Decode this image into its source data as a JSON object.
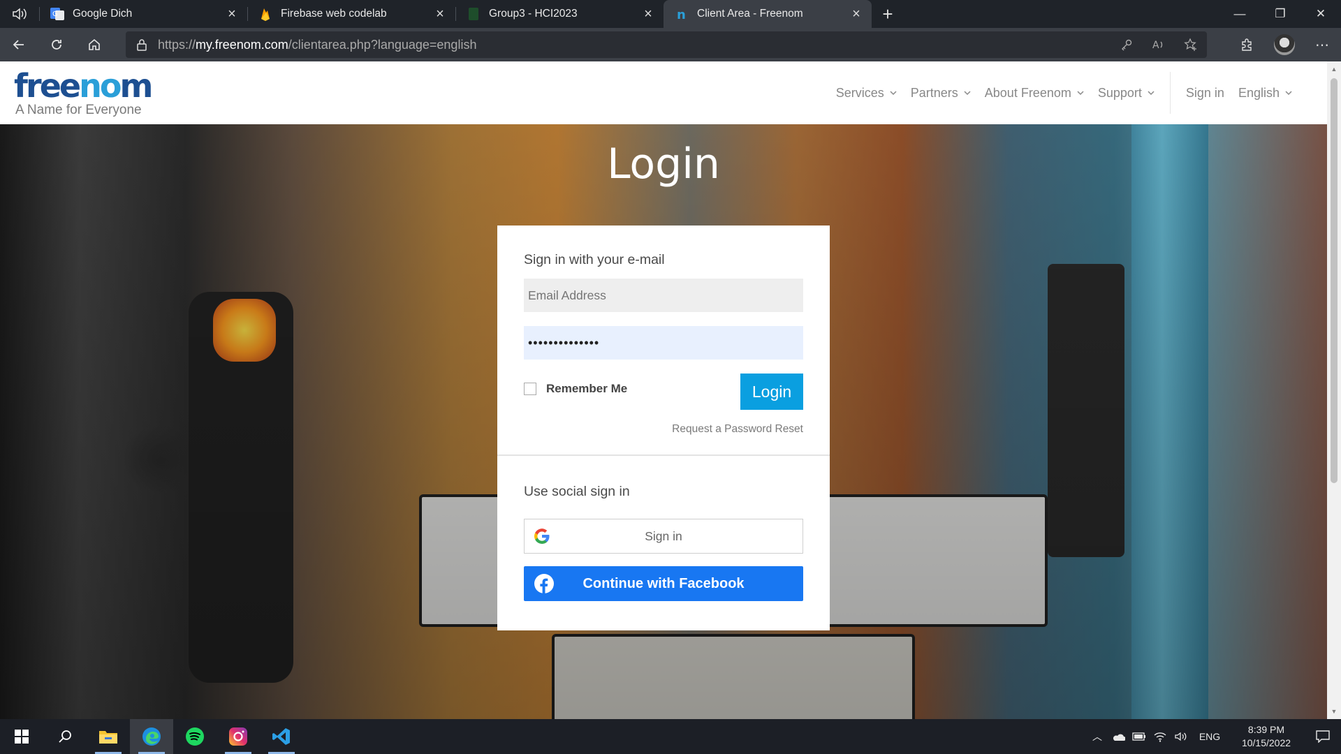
{
  "browser": {
    "tabs": [
      {
        "title": "Google Dich",
        "icon": "google-translate-icon",
        "active": false
      },
      {
        "title": "Firebase web codelab",
        "icon": "firebase-icon",
        "active": false
      },
      {
        "title": "Group3 - HCI2023",
        "icon": "sheets-icon",
        "active": false
      },
      {
        "title": "Client Area - Freenom",
        "icon": "freenom-icon",
        "active": true
      }
    ],
    "url_prefix": "https://",
    "url_host": "my.freenom.com",
    "url_path": "/clientarea.php?language=english"
  },
  "site": {
    "logo_text_a": "free",
    "logo_text_b": "no",
    "logo_text_c": "m",
    "tagline": "A Name for Everyone",
    "nav": [
      "Services",
      "Partners",
      "About Freenom",
      "Support"
    ],
    "sign_in": "Sign in",
    "language": "English",
    "brand_color": "#1d4f91",
    "accent_color": "#2a9fd8"
  },
  "hero": {
    "heading": "Login"
  },
  "login_card": {
    "email_heading": "Sign in with your e-mail",
    "email_placeholder": "Email Address",
    "password_value": "••••••••••••••",
    "remember_label": "Remember Me",
    "login_button": "Login",
    "reset_link": "Request a Password Reset",
    "social_heading": "Use social sign in",
    "google_button": "Sign in",
    "facebook_button": "Continue with Facebook",
    "login_button_color": "#0a9fe0",
    "facebook_color": "#1877f2"
  },
  "taskbar": {
    "apps": [
      "start-icon",
      "search-icon",
      "file-explorer-icon",
      "edge-icon",
      "spotify-icon",
      "instagram-icon",
      "vscode-icon"
    ],
    "language": "ENG",
    "time": "8:39 PM",
    "date": "10/15/2022"
  }
}
